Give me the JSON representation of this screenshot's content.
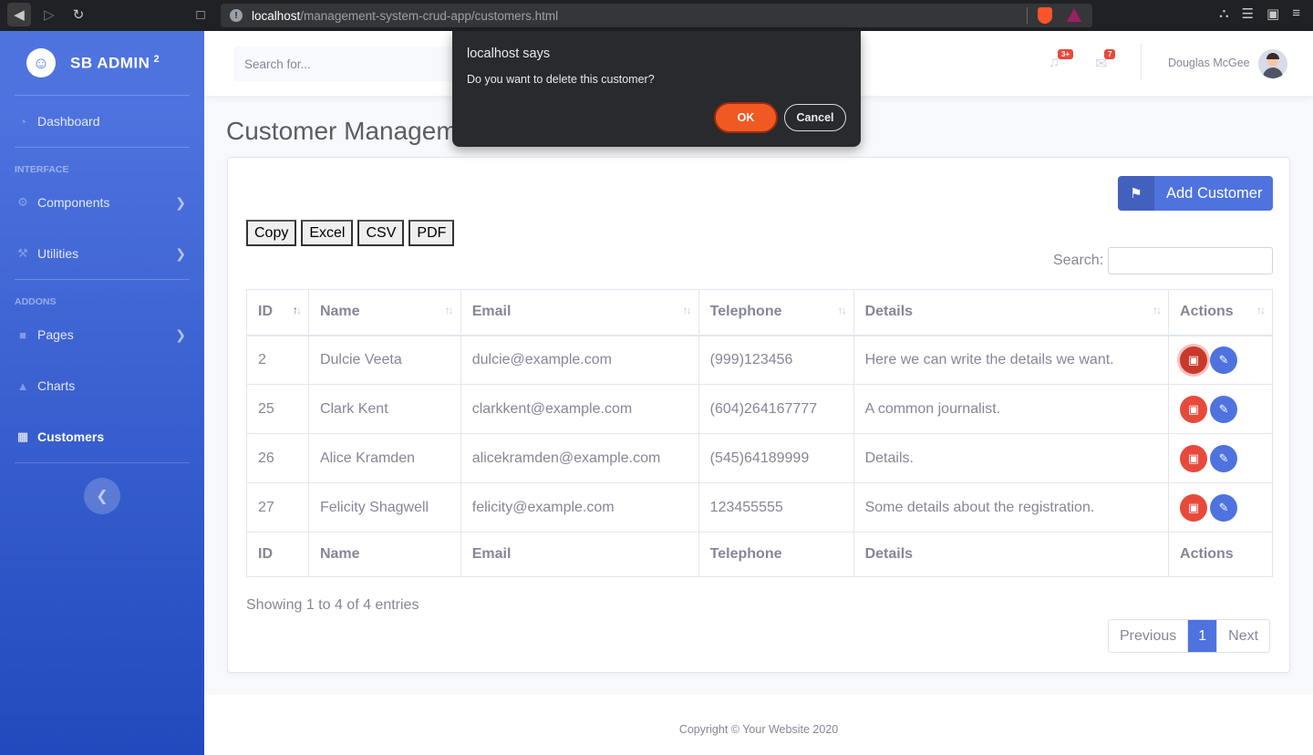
{
  "browser": {
    "url_host": "localhost",
    "url_path": "/management-system-crud-app/customers.html"
  },
  "sidebar": {
    "brand": "SB ADMIN",
    "brand_sup": "2",
    "items": {
      "dashboard": "Dashboard",
      "interface_heading": "Interface",
      "components": "Components",
      "utilities": "Utilities",
      "addons_heading": "Addons",
      "pages": "Pages",
      "charts": "Charts",
      "customers": "Customers"
    }
  },
  "topbar": {
    "search_placeholder": "Search for...",
    "alerts_badge": "3+",
    "messages_badge": "7",
    "user_name": "Douglas McGee"
  },
  "page": {
    "title": "Customer Management"
  },
  "card": {
    "add_button": "Add Customer",
    "export_buttons": [
      "Copy",
      "Excel",
      "CSV",
      "PDF"
    ],
    "search_label": "Search:",
    "columns": [
      "ID",
      "Name",
      "Email",
      "Telephone",
      "Details",
      "Actions"
    ],
    "rows": [
      {
        "id": "2",
        "name": "Dulcie Veeta",
        "email": "dulcie@example.com",
        "telephone": "(999)123456",
        "details": "Here we can write the details we want."
      },
      {
        "id": "25",
        "name": "Clark Kent",
        "email": "clarkkent@example.com",
        "telephone": "(604)264167777",
        "details": "A common journalist."
      },
      {
        "id": "26",
        "name": "Alice Kramden",
        "email": "alicekramden@example.com",
        "telephone": "(545)64189999",
        "details": "Details."
      },
      {
        "id": "27",
        "name": "Felicity Shagwell",
        "email": "felicity@example.com",
        "telephone": "123455555",
        "details": "Some details about the registration."
      }
    ],
    "info": "Showing 1 to 4 of 4 entries",
    "pagination": {
      "previous": "Previous",
      "current": "1",
      "next": "Next"
    }
  },
  "footer": {
    "copyright": "Copyright © Your Website 2020"
  },
  "dialog": {
    "title": "localhost says",
    "message": "Do you want to delete this customer?",
    "ok": "OK",
    "cancel": "Cancel"
  },
  "colors": {
    "primary": "#4e73df",
    "danger": "#e74a3b",
    "dialog_ok": "#f05a22"
  }
}
